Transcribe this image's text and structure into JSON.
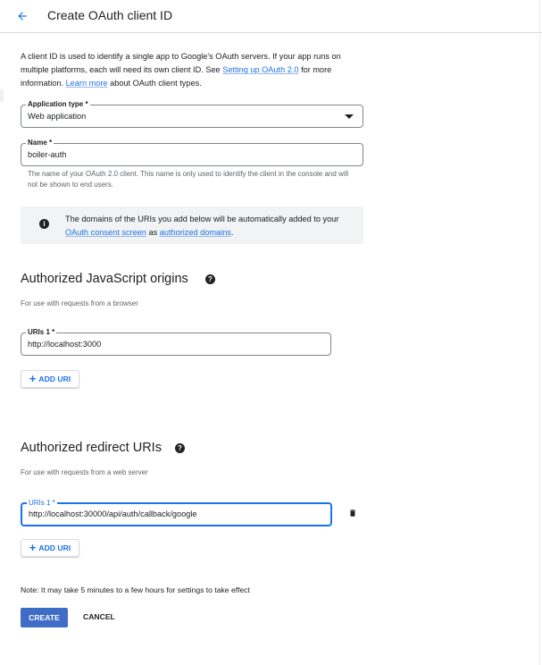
{
  "header": {
    "title": "Create OAuth client ID",
    "back_icon": "arrow-back-icon"
  },
  "intro": {
    "text_1": "A client ID is used to identify a single app to Google's OAuth servers. If your app runs on multiple platforms, each will need its own client ID. See ",
    "link_1": "Setting up OAuth 2.0",
    "text_2": " for more information. ",
    "link_2": "Learn more",
    "text_3": " about OAuth client types."
  },
  "application_type": {
    "label": "Application type *",
    "value": "Web application"
  },
  "name_field": {
    "label": "Name *",
    "value": "boiler-auth",
    "helper": "The name of your OAuth 2.0 client. This name is only used to identify the client in the console and will not be shown to end users."
  },
  "info": {
    "text_1": "The domains of the URIs you add below will be automatically added to your ",
    "link_1": "OAuth consent screen",
    "text_2": " as ",
    "link_2": "authorized domains",
    "text_3": "."
  },
  "js_origins": {
    "title": "Authorized JavaScript origins",
    "subtitle": "For use with requests from a browser",
    "uri_label": "URIs 1 *",
    "uri_value": "http://localhost:3000",
    "add_label": "ADD URI"
  },
  "redirect_uris": {
    "title": "Authorized redirect URIs",
    "subtitle": "For use with requests from a web server",
    "uri_label": "URIs 1 *",
    "uri_value": "http://localhost:30000/api/auth/callback/google",
    "add_label": "ADD URI"
  },
  "footer": {
    "note": "Note: It may take 5 minutes to a few hours for settings to take effect",
    "create_label": "CREATE",
    "cancel_label": "CANCEL"
  },
  "colors": {
    "accent": "#1a73e8",
    "primary_button": "#3f6cc7",
    "focus_border": "#1a73e8",
    "info_bg": "#f1f3f4"
  }
}
